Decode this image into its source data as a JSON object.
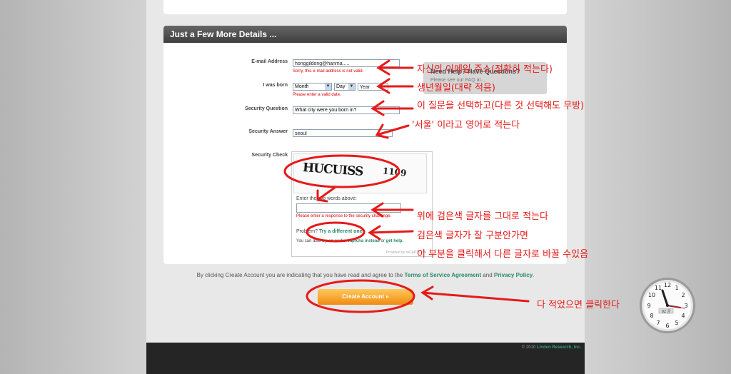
{
  "form": {
    "section_title": "Just a Few More Details ...",
    "email": {
      "label": "E-mail Address",
      "value": "honggildong@hanma.....",
      "error": "Sorry, this e-mail address is not valid."
    },
    "born": {
      "label": "I was born",
      "month": "Month",
      "day": "Day",
      "year": "Year",
      "error": "Please enter a valid date."
    },
    "question": {
      "label": "Security Question",
      "value": "What city were you born in?"
    },
    "answer": {
      "label": "Security Answer",
      "value": "seoul"
    },
    "check": {
      "label": "Security Check"
    }
  },
  "help": {
    "title": "Need Help? Have Questions?",
    "sub": "Please see our FAQ at..."
  },
  "captcha": {
    "word1": "HUCUISS",
    "word2": "1109",
    "instructions": "Enter the two words above:",
    "error": "Please enter a response to the security challenge.",
    "problem_text": "Problem?",
    "different_link": "Try a different one",
    "audio_prefix": "You can also",
    "audio_link": "try an audio captcha instead",
    "or": "or",
    "help_link": "get help.",
    "brand": "Provided by reCAPTCHA"
  },
  "terms": {
    "prefix": "By clicking Create Account you are indicating that you have read and agree to the",
    "tos": "Terms of Service Agreement",
    "and": "and",
    "privacy": "Privacy Policy",
    "suffix": "."
  },
  "create_button": "Create Account »",
  "footer": {
    "copyright": "© 2010",
    "company": "Linden Research, Inc."
  },
  "annotations": {
    "email": "자신의 이메일 주소(정확히 적는다)",
    "born": "생년월일(대략 적음)",
    "question": "이 질문을 선택하고(다른 것 선택해도 무방)",
    "answer": "'서울' 이라고 영어로 적는다",
    "captcha_type": "위에 검은색 글자를 그대로 적는다",
    "captcha_hard": "검은색 글자가 잘 구분안가면",
    "captcha_change": "이 부분을 클릭해서 다른 글자로 바꿀 수있음",
    "click": "다 적었으면 클릭한다"
  },
  "clock": {
    "date_label": "02 금"
  },
  "colors": {
    "annotation": "#e51a1a",
    "accent": "#2a8a6a",
    "button": "#f59a20"
  }
}
